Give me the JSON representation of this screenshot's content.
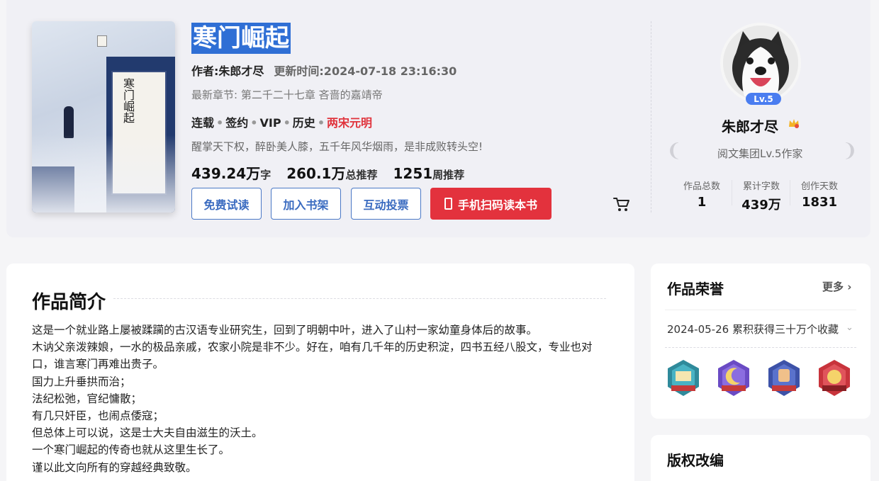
{
  "book": {
    "title": "寒门崛起",
    "author_line": "作者:朱郎才尽",
    "update_line": "更新时间:2024-07-18 23:16:30",
    "latest_chapter": "最新章节: 第二千二十七章 吝啬的嘉靖帝",
    "tags": [
      "连载",
      "签约",
      "VIP",
      "历史"
    ],
    "tag_highlight": "两宋元明",
    "tagline": "醒掌天下权，醉卧美人膝，五千年风华烟雨，是非成败转头空!",
    "word_count": "439.24万",
    "word_unit": "字",
    "total_recommend": "260.1万",
    "total_recommend_label": "总推荐",
    "weekly_recommend": "1251",
    "weekly_recommend_label": "周推荐",
    "cover_text": "寒门崛起"
  },
  "actions": {
    "free_trial": "免费试读",
    "add_shelf": "加入书架",
    "vote": "互动投票",
    "mobile_read": "手机扫码读本书"
  },
  "author": {
    "level": "Lv.5",
    "name": "朱郎才尽",
    "title": "阅文集团Lv.5作家",
    "stats": [
      {
        "label": "作品总数",
        "value": "1"
      },
      {
        "label": "累计字数",
        "value": "439万"
      },
      {
        "label": "创作天数",
        "value": "1831"
      }
    ]
  },
  "intro_section": {
    "heading": "作品简介",
    "lines": [
      "这是一个就业路上屡被蹂躏的古汉语专业研究生，回到了明朝中叶，进入了山村一家幼童身体后的故事。",
      "木讷父亲泼辣娘，一水的极品亲戚，农家小院是非不少。好在，咱有几千年的历史积淀，四书五经八股文，专业也对口，谁言寒门再难出贵子。",
      "国力上升垂拱而治；",
      "法纪松弛，官纪慵散；",
      "有几只奸臣，也闹点倭寇；",
      "但总体上可以说，这是士大夫自由滋生的沃土。",
      "一个寒门崛起的传奇也就从这里生长了。",
      "谨以此文向所有的穿越经典致敬。"
    ]
  },
  "honor_section": {
    "heading": "作品荣誉",
    "more": "更多",
    "item": "2024-05-26 累积获得三十万个收藏",
    "medals": [
      {
        "icon": "flag-medal-icon",
        "color": "#2f8a9b"
      },
      {
        "icon": "moon-medal-icon",
        "color": "#6a4bc4"
      },
      {
        "icon": "fist-medal-icon",
        "color": "#3d52a8"
      },
      {
        "icon": "quality-medal-icon",
        "color": "#c8343c"
      }
    ]
  },
  "copyright_section": {
    "heading": "版权改编"
  }
}
